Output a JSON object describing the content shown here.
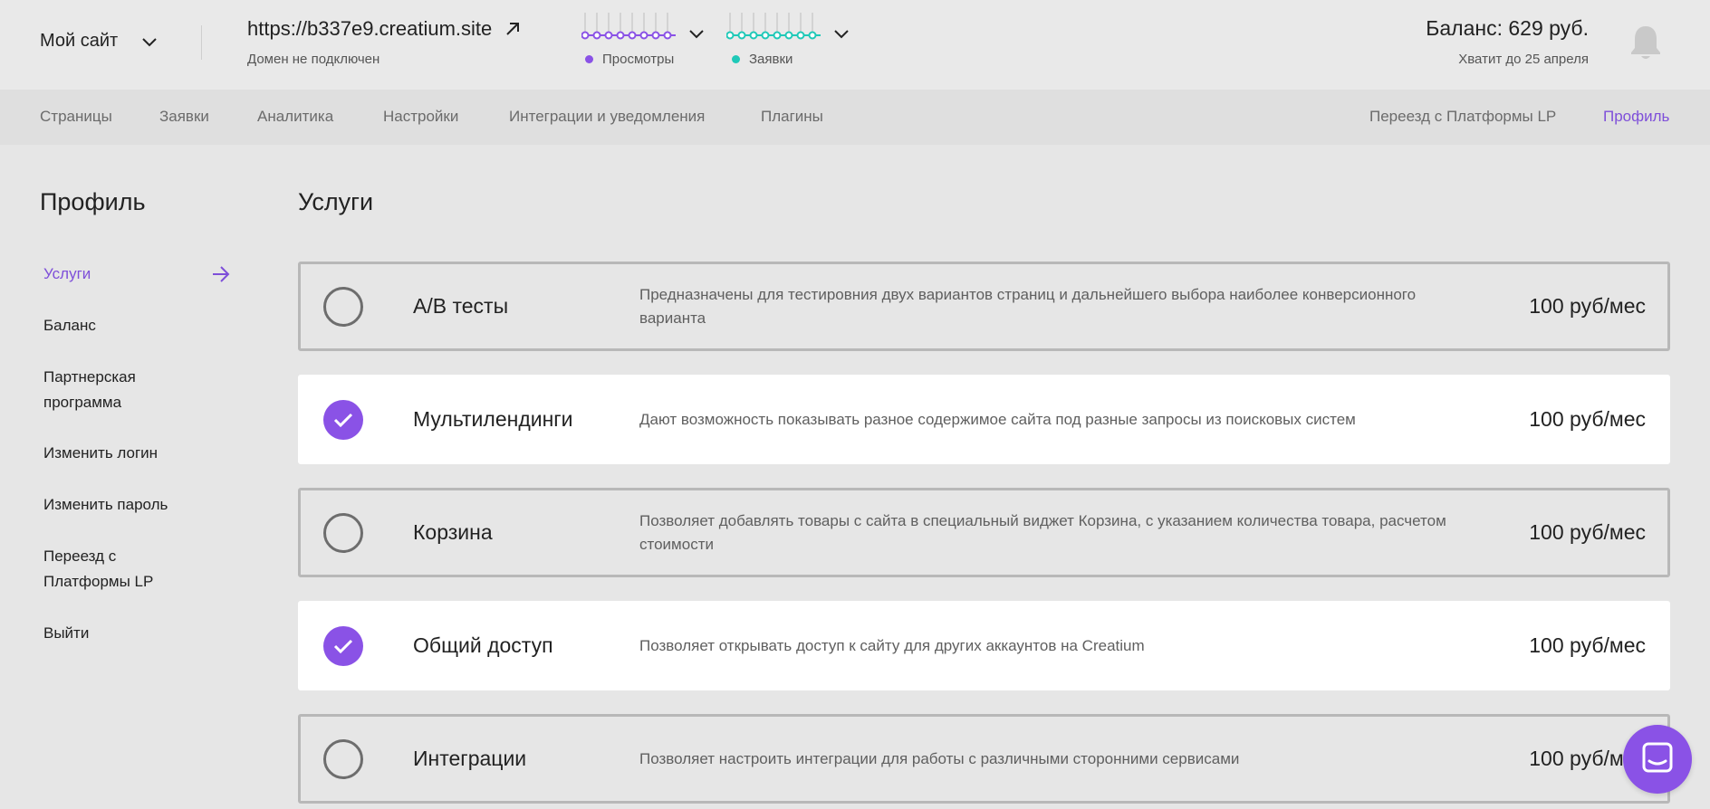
{
  "header": {
    "site_selector": "Мой сайт",
    "domain_url": "https://b337e9.creatium.site",
    "domain_status": "Домен не подключен",
    "views_label": "Просмотры",
    "requests_label": "Заявки",
    "balance": "Баланс: 629 руб.",
    "balance_until": "Хватит до 25 апреля"
  },
  "colors": {
    "accent": "#8a52e6",
    "views": "#8a52e6",
    "requests": "#1fc9b8"
  },
  "nav": {
    "items": [
      "Страницы",
      "Заявки",
      "Аналитика",
      "Настройки",
      "Интеграции и уведомления",
      "Плагины"
    ],
    "right_items": [
      "Переезд с Платформы LP",
      "Профиль"
    ]
  },
  "sidebar": {
    "title": "Профиль",
    "items": [
      "Услуги",
      "Баланс",
      "Партнерская программа",
      "Изменить логин",
      "Изменить пароль",
      "Переезд с Платформы LP",
      "Выйти"
    ]
  },
  "main": {
    "title": "Услуги",
    "services": [
      {
        "name": "A/B тесты",
        "description": "Предназначены для тестировния двух вариантов страниц и дальнейшего выбора наиболее конверсионного варианта",
        "price": "100 руб/мес",
        "enabled": false
      },
      {
        "name": "Мультилендинги",
        "description": "Дают возможность показывать разное содержимое сайта под разные запросы из поисковых систем",
        "price": "100 руб/мес",
        "enabled": true
      },
      {
        "name": "Корзина",
        "description": "Позволяет добавлять товары с сайта в специальный виджет Корзина, с указанием количества товара, расчетом стоимости",
        "price": "100 руб/мес",
        "enabled": false
      },
      {
        "name": "Общий доступ",
        "description": "Позволяет открывать доступ к сайту для других аккаунтов на Creatium",
        "price": "100 руб/мес",
        "enabled": true
      },
      {
        "name": "Интеграции",
        "description": "Позволяет настроить интеграции для работы с различными сторонними сервисами",
        "price": "100 руб/мес",
        "enabled": false
      }
    ]
  },
  "icons": [
    "chevron-down-icon",
    "external-link-icon",
    "bell-icon",
    "arrow-right-icon",
    "check-icon",
    "chat-icon"
  ]
}
